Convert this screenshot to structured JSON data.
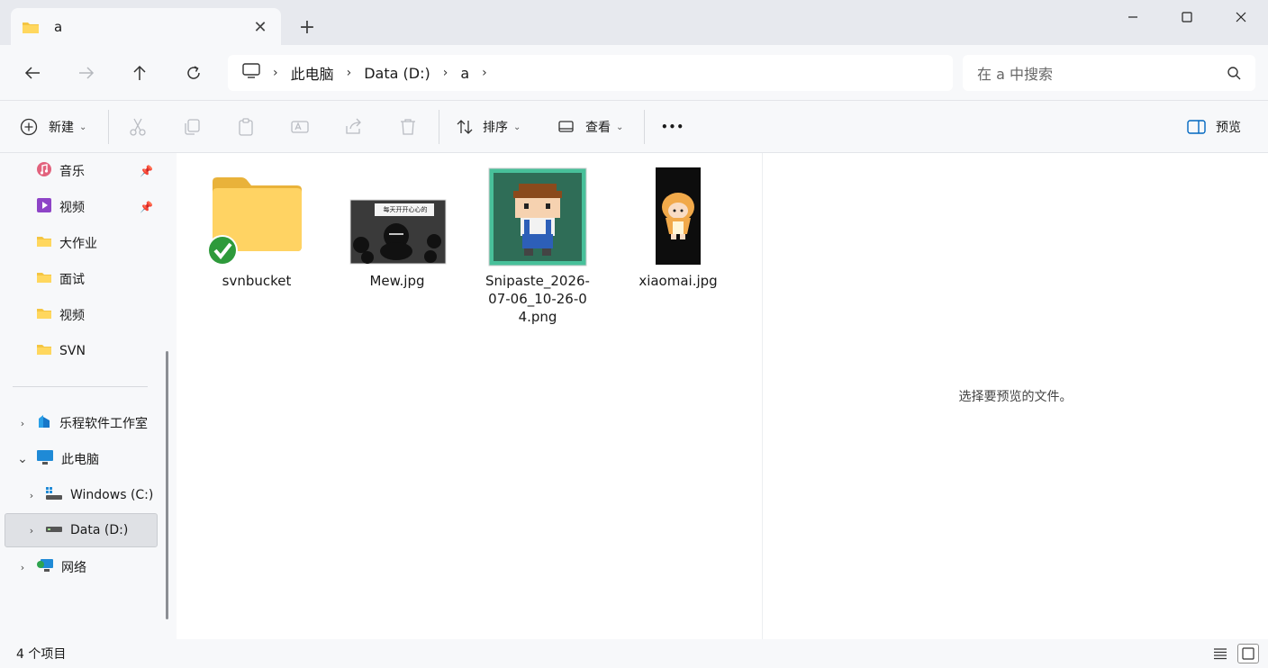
{
  "tab": {
    "title": "a",
    "close": "✕",
    "new_tab": "+"
  },
  "window": {
    "minimize": "—",
    "maximize": "☐",
    "close": "✕"
  },
  "address": {
    "segments": [
      "此电脑",
      "Data (D:)",
      "a"
    ],
    "separator": "›"
  },
  "search": {
    "placeholder": "在 a 中搜索"
  },
  "toolbar": {
    "new_label": "新建",
    "sort_label": "排序",
    "view_label": "查看",
    "more_label": "•••",
    "preview_label": "预览"
  },
  "sidebar": {
    "items": [
      {
        "label": "音乐",
        "pinned": true,
        "icon": "music-icon"
      },
      {
        "label": "视频",
        "pinned": true,
        "icon": "video-icon"
      },
      {
        "label": "大作业",
        "icon": "folder-icon"
      },
      {
        "label": "面试",
        "icon": "folder-icon"
      },
      {
        "label": "视频",
        "icon": "folder-icon"
      },
      {
        "label": "SVN",
        "icon": "folder-icon"
      },
      {
        "label": "乐程软件工作室",
        "expander": "›",
        "icon": "cloud-folder-icon"
      },
      {
        "label": "此电脑",
        "expander": "⌄",
        "icon": "computer-icon"
      },
      {
        "label": "Windows (C:)",
        "expander": "›",
        "icon": "windows-drive-icon"
      },
      {
        "label": "Data (D:)",
        "expander": "›",
        "icon": "drive-icon",
        "selected": true
      },
      {
        "label": "网络",
        "expander": "›",
        "icon": "network-icon"
      }
    ]
  },
  "files": [
    {
      "name": "svnbucket",
      "type": "folder",
      "badge": "svn-ok-icon"
    },
    {
      "name": "Mew.jpg",
      "type": "image",
      "thumb_text": "每天开开心心的"
    },
    {
      "name": "Snipaste_2026-07-06_10-26-04.png",
      "type": "image"
    },
    {
      "name": "xiaomai.jpg",
      "type": "image"
    }
  ],
  "preview": {
    "message": "选择要预览的文件。"
  },
  "status": {
    "count": "4 个项目"
  },
  "colors": {
    "accent": "#0067c0",
    "folder": "#f4c542",
    "selection": "#dfe1e5"
  }
}
